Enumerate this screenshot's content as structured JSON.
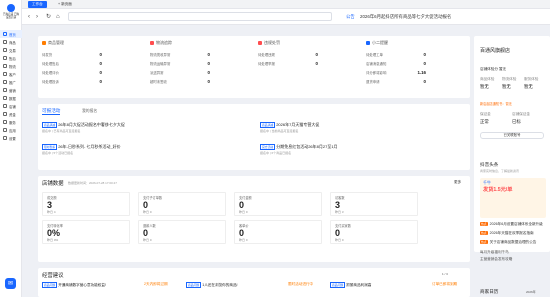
{
  "sidebar": {
    "logo_text": "已购店铺\n已购设置店铺",
    "items": [
      "首页",
      "商品",
      "交易",
      "售后",
      "物流",
      "客户",
      "推广",
      "营销",
      "数据",
      "店铺",
      "资金",
      "服务",
      "应用",
      "设置"
    ],
    "active_index": 0,
    "bottom_icon": "chat-icon"
  },
  "topbar": {
    "tab_main": "工作台",
    "tab_add": "+ 新页面"
  },
  "toolbar": {
    "back": "‹",
    "forward": "›",
    "reload": "↻",
    "home": "⌂",
    "notice_tag": "公告",
    "notice_text": "2026年6月起抖店所有商品等七夕大促活动报名"
  },
  "stats": {
    "groups": [
      {
        "title": "商品管理",
        "color": "#ff7d00",
        "rows": [
          [
            "待发货",
            "0"
          ],
          [
            "待处理售后",
            "0"
          ],
          [
            "待处理评价",
            "0"
          ],
          [
            "待处理投诉",
            "0"
          ]
        ]
      },
      {
        "title": "物流追踪",
        "color": "#ff4d4f",
        "rows": [
          [
            "物流揽收异常",
            "0"
          ],
          [
            "物流运输异常",
            "0"
          ],
          [
            "派送异常",
            "0"
          ],
          [
            "超时未签收",
            "0"
          ]
        ]
      },
      {
        "title": "违规处罚",
        "color": "#ff4d4f",
        "rows": [
          [
            "待处理违规",
            "0"
          ],
          [
            "待处理举报",
            "0"
          ],
          [
            "",
            ""
          ],
          [
            "",
            ""
          ]
        ]
      },
      {
        "title": "小二提醒",
        "color": "#1966ff",
        "rows": [
          [
            "待处理工单",
            "0"
          ],
          [
            "店铺消息通知",
            "0"
          ],
          [
            "评分即将影响",
            "1.16"
          ],
          [
            "退货申请",
            "0"
          ]
        ]
      }
    ]
  },
  "activity": {
    "tab_active": "可报活动",
    "tab_other": "我的报名",
    "left": [
      {
        "badge": "商品满减",
        "title": "26年8月大促活动报名中奢侈七夕大促",
        "sub": "报名中 | 已有商品可直接报名"
      },
      {
        "badge": "限时秒杀",
        "title": "26年-日秒系列- 七月秒杀活动_好价",
        "sub": "报名中 | 5个活动已报名"
      }
    ],
    "right": [
      {
        "badge": "商品满减",
        "title": "2026年7月天猫专营大促",
        "sub": "报名中 | 当前商品可直接报名"
      },
      {
        "badge": "官方活动",
        "title": "分期免息红包活动26年8月27至1月",
        "sub": "报名中 | 6个商品已报名"
      }
    ]
  },
  "shop_data": {
    "title": "店铺数据",
    "updated": "数据更新时间：2026-07-28 17:00:47",
    "more": "更多",
    "metrics": [
      {
        "label": "成交额",
        "value": "3",
        "sub": "昨日 4"
      },
      {
        "label": "支付子订单数",
        "value": "0",
        "sub": "昨日 0"
      },
      {
        "label": "支付金额",
        "value": "0",
        "sub": "昨日 0"
      },
      {
        "label": "访客数",
        "value": "3",
        "sub": "昨日 3"
      },
      {
        "label": "支付转化率",
        "value": "0%",
        "sub": "昨日 0%"
      },
      {
        "label": "退款人数",
        "value": "0",
        "sub": "昨日 0"
      },
      {
        "label": "客单价",
        "value": "0",
        "sub": "昨日 0"
      },
      {
        "label": "支付买家数",
        "value": "0",
        "sub": "昨日 0"
      }
    ]
  },
  "ops": {
    "title": "经营建议",
    "page": "1 / 3",
    "rows": [
      {
        "tag": "商品问题",
        "text": "开通商铺数字营心意功能权益!",
        "action": "2天内即将过期"
      },
      {
        "tag": "商品问题",
        "text": "1人还在浏览你的商品!",
        "action": "限时活动进行中"
      },
      {
        "tag": "商品问题",
        "text": "抓紧商品利润高",
        "action": "订单已即将到期"
      }
    ]
  },
  "right_panel": {
    "shop_name": "百通风旗舰店",
    "pill": "店铺体验分 暂无",
    "tabs": [
      "商品体验",
      "物流体验",
      "服务体验"
    ],
    "values": [
      "暂无",
      "暂无",
      "暂无"
    ],
    "notice": "新店起店通知书：暂无",
    "labels": [
      "保证金",
      "店铺保证金"
    ],
    "values2": [
      "正常",
      "已标"
    ],
    "button": "已关联账号",
    "news_title": "抖音头条",
    "news_sub": "商家实时信息，了解最新资讯",
    "banner_title": "千牛",
    "banner_main": "发货1.5元/单",
    "news": [
      {
        "tag": "热点",
        "text": "2026年6月设置店铺体系全新升级"
      },
      {
        "tag": "热点",
        "text": "2026年天猫狂欢季报名指南"
      },
      {
        "tag": "热点",
        "text": "关于店铺商品数据治理的公告"
      }
    ],
    "links": [
      "每月升级福利千鸟",
      "主营营销会发布攻略"
    ],
    "calendar_title": "商家日历",
    "calendar_month": "2026年"
  }
}
